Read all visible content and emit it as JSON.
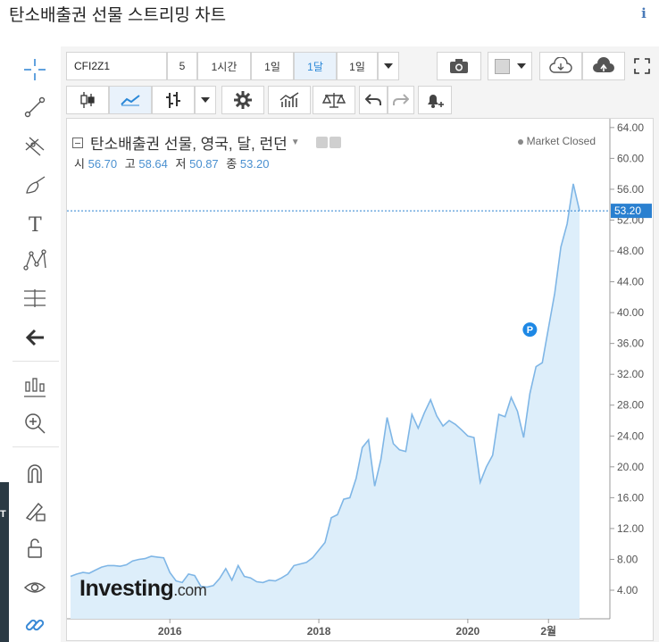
{
  "page": {
    "title": "탄소배출권 선물 스트리밍 차트"
  },
  "toolbar": {
    "symbol": "CFI2Z1",
    "intervals": [
      "5",
      "1시간",
      "1일",
      "1달",
      "1일"
    ],
    "active_interval": "1달"
  },
  "legend": {
    "title": "탄소배출권 선물, 영국, 달, 런던",
    "market_status": "Market Closed",
    "ohlc": [
      {
        "label": "시",
        "value": "56.70"
      },
      {
        "label": "고",
        "value": "58.64"
      },
      {
        "label": "저",
        "value": "50.87"
      },
      {
        "label": "종",
        "value": "53.20"
      }
    ]
  },
  "watermark": {
    "brand": "Investing",
    "suffix": ".com"
  },
  "colors": {
    "line": "#7fb6e6",
    "fill": "#ddeefa",
    "last_price_badge": "#2a80d0",
    "marker": "#1e88e5",
    "accent": "#2a88d8"
  },
  "chart_data": {
    "type": "area",
    "title": "탄소배출권 선물, 영국, 달, 런던",
    "x_axis_type": "date",
    "x_ticks": [
      {
        "date": "2016-01",
        "label": "2016"
      },
      {
        "date": "2018-01",
        "label": "2018"
      },
      {
        "date": "2020-01",
        "label": "2020"
      },
      {
        "date": "2021-02",
        "label": "2월"
      }
    ],
    "y_ticks": [
      4,
      8,
      12,
      16,
      20,
      24,
      28,
      32,
      36,
      40,
      44,
      48,
      52,
      56,
      60,
      64
    ],
    "ylim": [
      0,
      65
    ],
    "last_price": 53.2,
    "last_price_label": "53.20",
    "marker": {
      "date": "2020-11",
      "value": 37.8,
      "label": "P"
    },
    "series": [
      {
        "values": [
          [
            "2014-09",
            5.8
          ],
          [
            "2014-10",
            6.1
          ],
          [
            "2014-11",
            6.3
          ],
          [
            "2014-12",
            6.2
          ],
          [
            "2015-01",
            6.6
          ],
          [
            "2015-02",
            7.0
          ],
          [
            "2015-03",
            7.2
          ],
          [
            "2015-04",
            7.2
          ],
          [
            "2015-05",
            7.1
          ],
          [
            "2015-06",
            7.3
          ],
          [
            "2015-07",
            7.8
          ],
          [
            "2015-08",
            8.0
          ],
          [
            "2015-09",
            8.1
          ],
          [
            "2015-10",
            8.4
          ],
          [
            "2015-11",
            8.3
          ],
          [
            "2015-12",
            8.2
          ],
          [
            "2016-01",
            6.3
          ],
          [
            "2016-02",
            5.2
          ],
          [
            "2016-03",
            5.0
          ],
          [
            "2016-04",
            6.1
          ],
          [
            "2016-05",
            5.9
          ],
          [
            "2016-06",
            4.5
          ],
          [
            "2016-07",
            4.4
          ],
          [
            "2016-08",
            4.6
          ],
          [
            "2016-09",
            5.5
          ],
          [
            "2016-10",
            6.8
          ],
          [
            "2016-11",
            5.3
          ],
          [
            "2016-12",
            7.2
          ],
          [
            "2017-01",
            5.8
          ],
          [
            "2017-02",
            5.6
          ],
          [
            "2017-03",
            5.1
          ],
          [
            "2017-04",
            5.0
          ],
          [
            "2017-05",
            5.3
          ],
          [
            "2017-06",
            5.2
          ],
          [
            "2017-07",
            5.6
          ],
          [
            "2017-08",
            6.1
          ],
          [
            "2017-09",
            7.2
          ],
          [
            "2017-10",
            7.4
          ],
          [
            "2017-11",
            7.6
          ],
          [
            "2017-12",
            8.2
          ],
          [
            "2018-01",
            9.2
          ],
          [
            "2018-02",
            10.2
          ],
          [
            "2018-03",
            13.4
          ],
          [
            "2018-04",
            13.8
          ],
          [
            "2018-05",
            15.8
          ],
          [
            "2018-06",
            16.0
          ],
          [
            "2018-07",
            18.5
          ],
          [
            "2018-08",
            22.5
          ],
          [
            "2018-09",
            23.5
          ],
          [
            "2018-10",
            17.5
          ],
          [
            "2018-11",
            21.0
          ],
          [
            "2018-12",
            26.4
          ],
          [
            "2019-01",
            23.0
          ],
          [
            "2019-02",
            22.2
          ],
          [
            "2019-03",
            22.0
          ],
          [
            "2019-04",
            26.8
          ],
          [
            "2019-05",
            25.0
          ],
          [
            "2019-06",
            27.0
          ],
          [
            "2019-07",
            28.7
          ],
          [
            "2019-08",
            26.6
          ],
          [
            "2019-09",
            25.3
          ],
          [
            "2019-10",
            26.0
          ],
          [
            "2019-11",
            25.5
          ],
          [
            "2019-12",
            24.8
          ],
          [
            "2020-01",
            24.0
          ],
          [
            "2020-02",
            23.8
          ],
          [
            "2020-03",
            18.0
          ],
          [
            "2020-04",
            20.0
          ],
          [
            "2020-05",
            21.5
          ],
          [
            "2020-06",
            26.8
          ],
          [
            "2020-07",
            26.5
          ],
          [
            "2020-08",
            29.0
          ],
          [
            "2020-09",
            27.2
          ],
          [
            "2020-10",
            23.8
          ],
          [
            "2020-11",
            29.5
          ],
          [
            "2020-12",
            33.0
          ],
          [
            "2021-01",
            33.5
          ],
          [
            "2021-02",
            38.0
          ],
          [
            "2021-03",
            42.5
          ],
          [
            "2021-04",
            48.5
          ],
          [
            "2021-05",
            51.5
          ],
          [
            "2021-06",
            56.7
          ],
          [
            "2021-07",
            53.2
          ]
        ]
      }
    ]
  }
}
